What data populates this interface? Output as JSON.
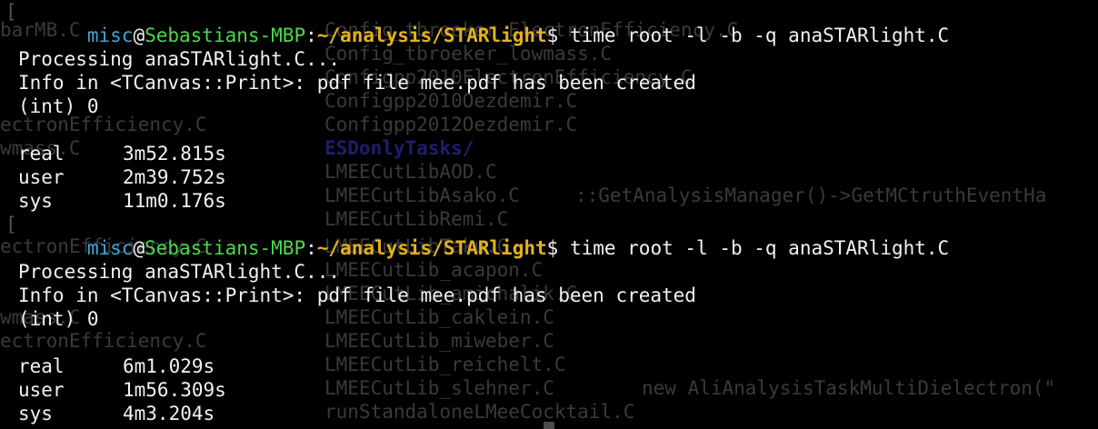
{
  "prompt": {
    "user": "misc",
    "at": "@",
    "host": "Sebastians-MBP",
    "colon": ":",
    "path": "~/analysis/STARlight",
    "dollar": "$"
  },
  "runs": [
    {
      "command": "time root -l -b -q anaSTARlight.C",
      "processing": "Processing anaSTARlight.C...",
      "info": "Info in <TCanvas::Print>: pdf file mee.pdf has been created",
      "result": "(int) 0",
      "timing": [
        {
          "label": "real",
          "value": "3m52.815s"
        },
        {
          "label": "user",
          "value": "2m39.752s"
        },
        {
          "label": "sys",
          "value": "11m0.176s"
        }
      ]
    },
    {
      "command": "time root -l -b -q anaSTARlight.C",
      "processing": "Processing anaSTARlight.C...",
      "info": "Info in <TCanvas::Print>: pdf file mee.pdf has been created",
      "result": "(int) 0",
      "timing": [
        {
          "label": "real",
          "value": "6m1.029s"
        },
        {
          "label": "user",
          "value": "1m56.309s"
        },
        {
          "label": "sys",
          "value": "4m3.204s"
        }
      ]
    }
  ],
  "background_ghost_text": {
    "listing": [
      "Config_tbroeker_ElectronEfficiency.C",
      "Config_tbroeker_lowmass.C",
      "Configpp2010ElectronEfficiency.C",
      "Configpp2010Oezdemir.C",
      "Configpp2012Oezdemir.C",
      "ESDonlyTasks/",
      "LMEECutLibAOD.C",
      "LMEECutLibAsako.C",
      "LMEECutLibRemi.C",
      "LMEECutLibTaku.C",
      "LMEECutLib_acapon.C",
      "LMEECutLib_amichalik.C",
      "LMEECutLib_caklein.C",
      "LMEECutLib_miweber.C",
      "LMEECutLib_reichelt.C",
      "LMEECutLib_slehner.C",
      "runStandaloneLMeeCocktail.C"
    ],
    "left_edge": [
      "barMB.C",
      "ectronEfficiency.C",
      "wmass.C",
      "ectronEfficiency.C",
      "wmass.C",
      "ectronEfficiency.C"
    ],
    "right_fragments": [
      "::GetAnalysisManager()->GetMCtruthEventHa",
      "new AliAnalysisTaskMultiDielectron(\""
    ]
  },
  "colors": {
    "background": "#000000",
    "text": "#f2f2f2",
    "prompt_user": "#3fa7d6",
    "prompt_host": "#4cd94c",
    "prompt_path": "#e0b21e",
    "ghost_text": "#3a3a3a",
    "ghost_dir": "#1e1e6a"
  }
}
